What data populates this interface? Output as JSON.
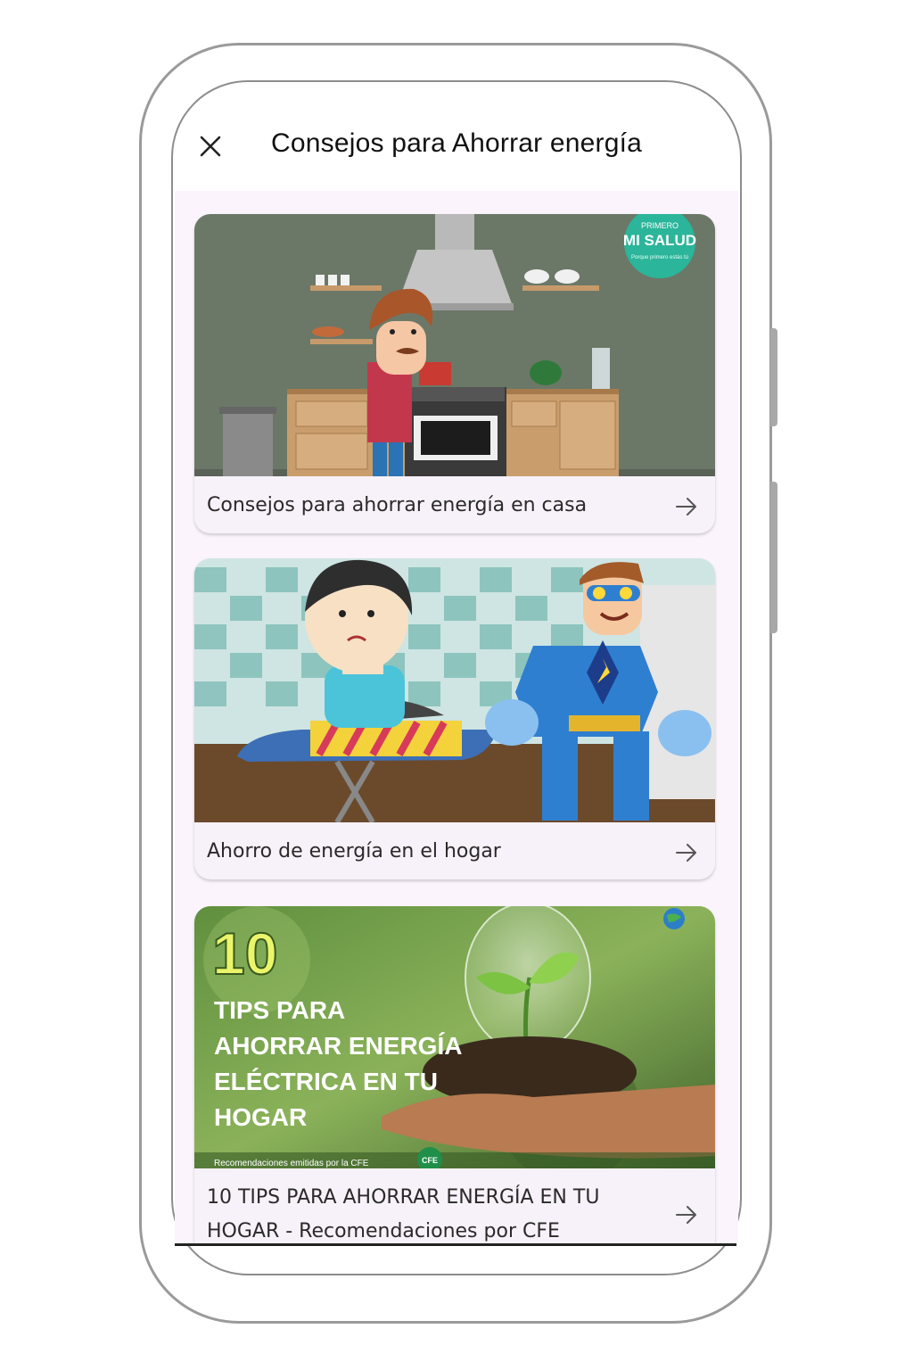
{
  "app": {
    "title": "Consejos para Ahorrar energía",
    "close_icon": "close-icon"
  },
  "cards": [
    {
      "label": "Consejos para ahorrar energía en casa",
      "badge_top": "PRIMERO",
      "badge_main": "MI SALUD",
      "badge_sub": "Porque primero estás tú",
      "icon": "arrow-right-icon"
    },
    {
      "label": "Ahorro de energía en el hogar",
      "icon": "arrow-right-icon"
    },
    {
      "label_line1": "10 TIPS PARA AHORRAR ENERGÍA EN TU",
      "label_line2": "HOGAR - Recomendaciones por CFE",
      "thumb_number": "10",
      "thumb_line1": "TIPS PARA",
      "thumb_line2": "AHORRAR ENERGÍA",
      "thumb_line3": "ELÉCTRICA EN TU",
      "thumb_line4": "HOGAR",
      "thumb_footer": "Recomendaciones emitidas por la CFE",
      "thumb_logo": "CFE",
      "icon": "arrow-right-icon"
    }
  ],
  "colors": {
    "screen_bg": "#fbf4fd",
    "card_bg": "#f7f1f9",
    "badge": "#2bb59a"
  }
}
